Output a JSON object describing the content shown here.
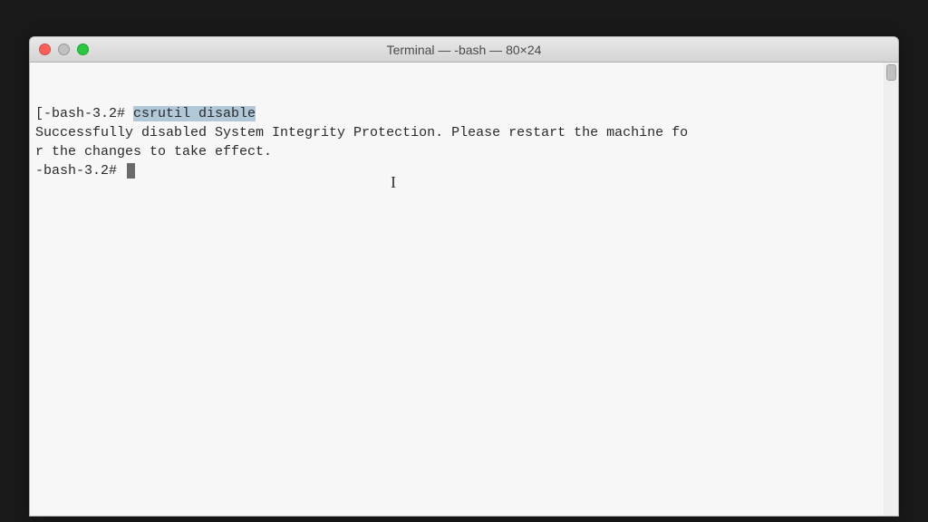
{
  "window": {
    "title": "Terminal — -bash — 80×24"
  },
  "terminal": {
    "line1_prompt": "[-bash-3.2# ",
    "line1_command": "csrutil disable",
    "output1": "Successfully disabled System Integrity Protection. Please restart the machine fo",
    "output2": "r the changes to take effect.",
    "line2_prompt": "-bash-3.2# "
  }
}
